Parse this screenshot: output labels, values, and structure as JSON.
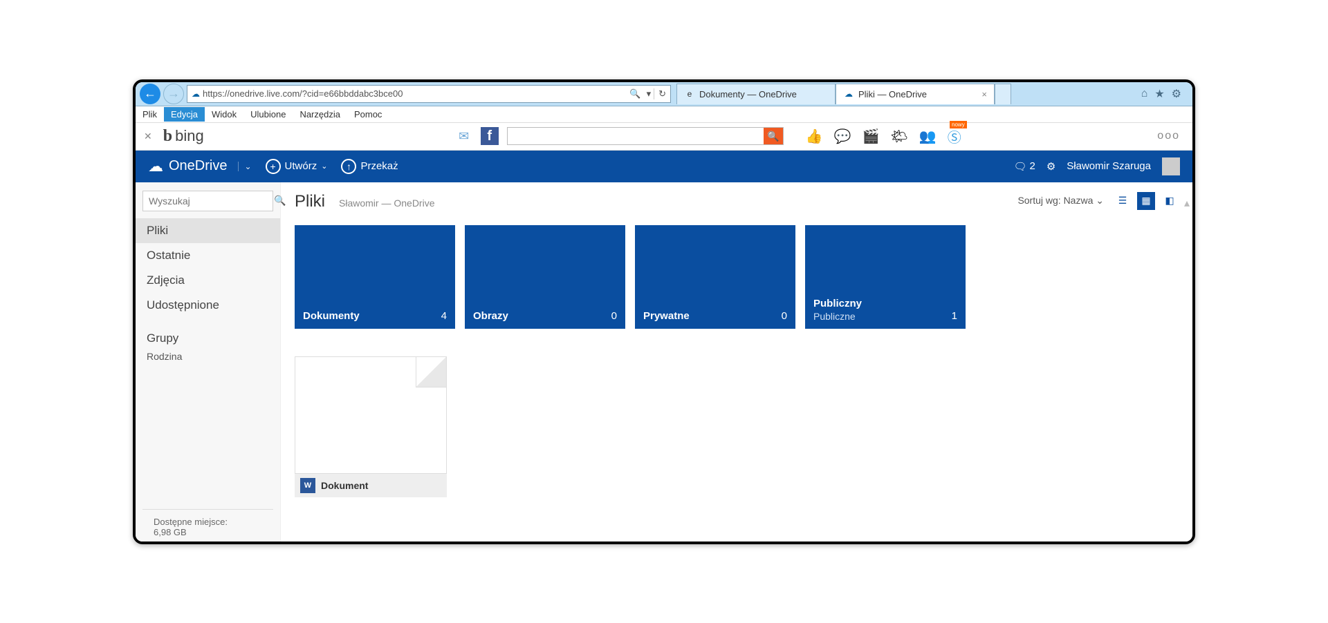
{
  "browser": {
    "url": "https://onedrive.live.com/?cid=e66bbddabc3bce00",
    "tabs": [
      {
        "title": "Dokumenty — OneDrive",
        "active": false
      },
      {
        "title": "Pliki — OneDrive",
        "active": true
      }
    ],
    "menu": [
      "Plik",
      "Edycja",
      "Widok",
      "Ulubione",
      "Narzędzia",
      "Pomoc"
    ],
    "menu_highlight_index": 1
  },
  "bing": {
    "label": "bing",
    "badge": "nowy",
    "more": "ooo"
  },
  "onedrive": {
    "brand": "OneDrive",
    "create_label": "Utwórz",
    "upload_label": "Przekaż",
    "msg_count": "2",
    "user_name": "Sławomir Szaruga"
  },
  "sidebar": {
    "search_placeholder": "Wyszukaj",
    "items": [
      "Pliki",
      "Ostatnie",
      "Zdjęcia",
      "Udostępnione"
    ],
    "active_index": 0,
    "group_header": "Grupy",
    "group_items": [
      "Rodzina"
    ],
    "storage_label": "Dostępne miejsce:",
    "storage_value": "6,98 GB"
  },
  "main": {
    "title": "Pliki",
    "path": "Sławomir — OneDrive",
    "sort_label": "Sortuj wg: Nazwa",
    "folders": [
      {
        "name": "Dokumenty",
        "count": "4"
      },
      {
        "name": "Obrazy",
        "count": "0"
      },
      {
        "name": "Prywatne",
        "count": "0"
      },
      {
        "name": "Publiczny",
        "sub": "Publiczne",
        "count": "1"
      }
    ],
    "files": [
      {
        "name": "Dokument",
        "icon_text": "W"
      }
    ]
  }
}
